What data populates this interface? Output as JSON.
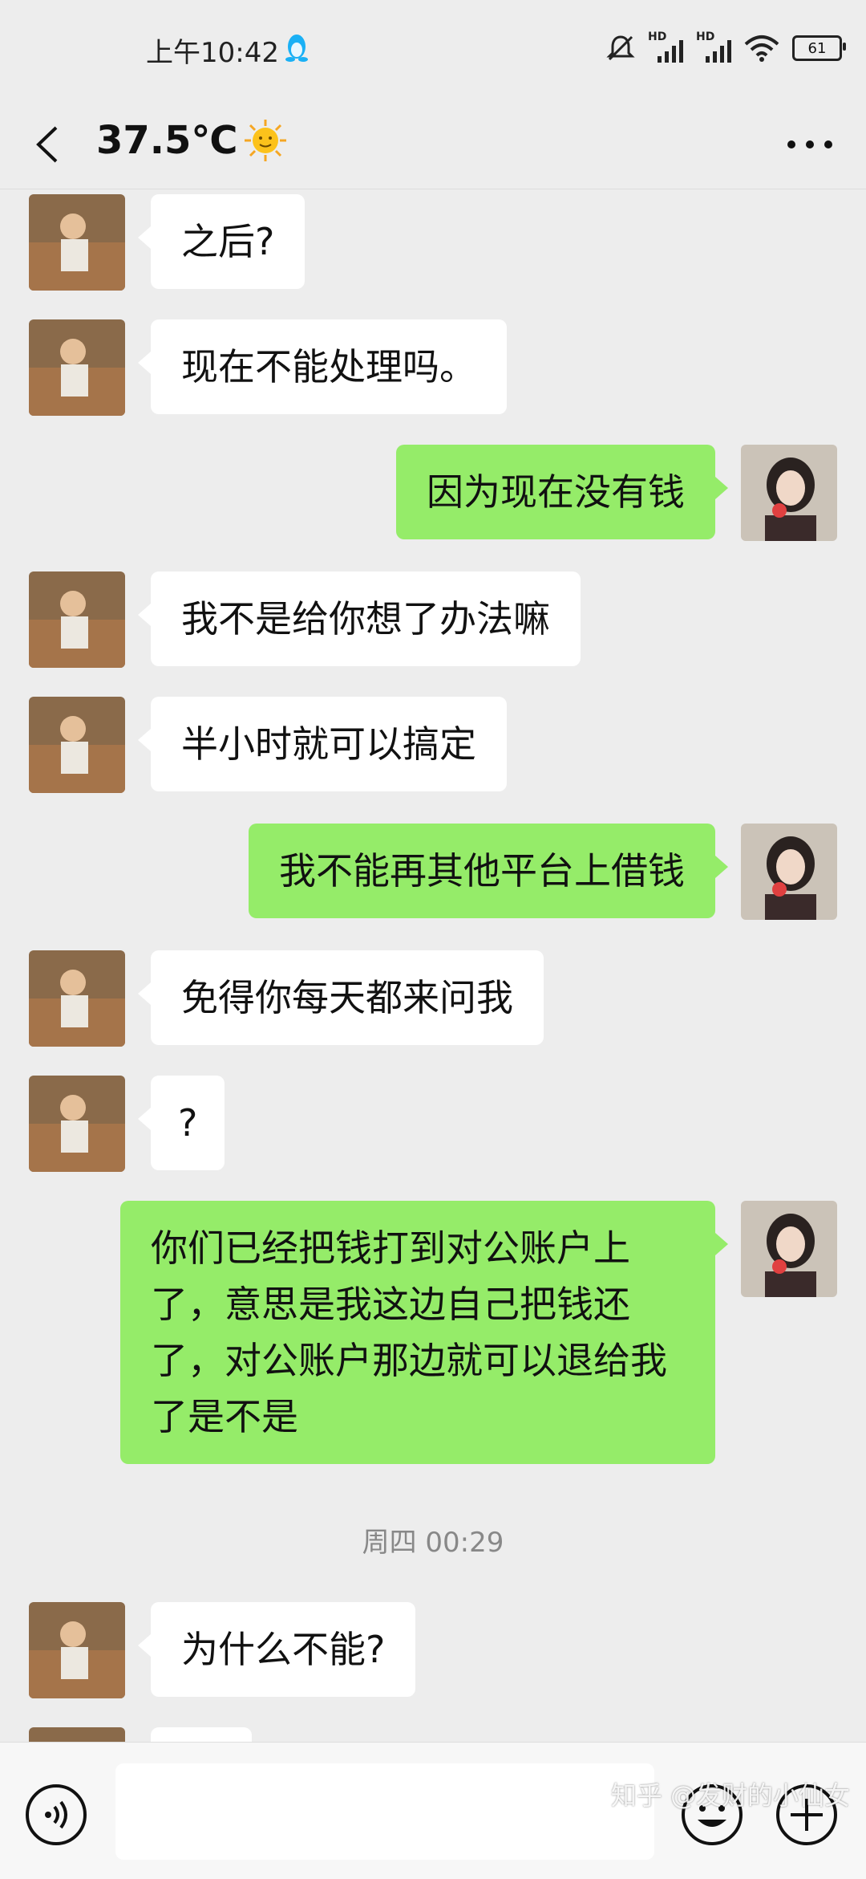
{
  "status_bar": {
    "time": "上午10:42",
    "battery": "61",
    "signal1": "HD",
    "signal2": "HD"
  },
  "header": {
    "title": "37.5℃"
  },
  "messages": [
    {
      "side": "in",
      "text": "之后?"
    },
    {
      "side": "in",
      "text": "现在不能处理吗。"
    },
    {
      "side": "out",
      "text": "因为现在没有钱"
    },
    {
      "side": "in",
      "text": "我不是给你想了办法嘛"
    },
    {
      "side": "in",
      "text": "半小时就可以搞定"
    },
    {
      "side": "out",
      "text": "我不能再其他平台上借钱"
    },
    {
      "side": "in",
      "text": "免得你每天都来问我"
    },
    {
      "side": "in",
      "text": "?"
    },
    {
      "side": "out",
      "text": "你们已经把钱打到对公账户上了，意思是我这边自己把钱还了，对公账户那边就可以退给我了是不是"
    },
    {
      "side": "in",
      "text": "为什么不能?"
    }
  ],
  "timestamp": "周四 00:29",
  "watermark": "知乎 @发财的小仙女",
  "icons": [
    "back-arrow-icon",
    "more-icon",
    "voice-icon",
    "emoji-icon",
    "plus-icon",
    "sun-emoji-icon",
    "qq-penguin-icon"
  ]
}
